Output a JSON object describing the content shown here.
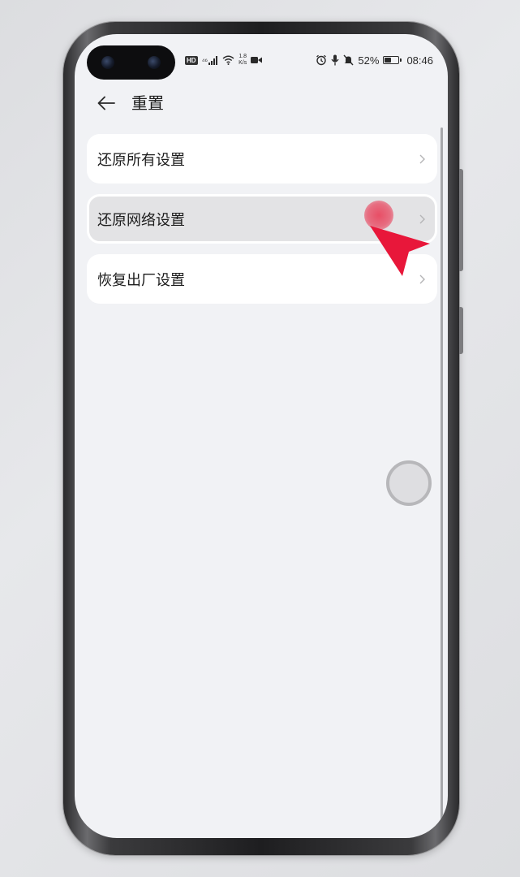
{
  "status_bar": {
    "hd": "HD",
    "signal_mark": "⁴⁶",
    "net_speed_value": "1.8",
    "net_speed_unit": "K/s",
    "battery_percent": "52%",
    "battery_level": 0.52,
    "time": "08:46"
  },
  "header": {
    "title": "重置"
  },
  "menu": {
    "items": [
      {
        "label": "还原所有设置",
        "pressed": false
      },
      {
        "label": "还原网络设置",
        "pressed": true
      },
      {
        "label": "恢复出厂设置",
        "pressed": false
      }
    ]
  },
  "colors": {
    "screen_bg": "#f1f2f5",
    "card_bg": "#ffffff",
    "pressed_card_bg": "#e3e3e5",
    "pointer_red": "#e8173a",
    "text": "#1c1c1c"
  },
  "icons": {
    "back": "arrow-left-icon",
    "chevron": "chevron-right-icon",
    "pointer": "red-pointer-arrow-icon",
    "assist": "floating-assist-ball-icon"
  }
}
